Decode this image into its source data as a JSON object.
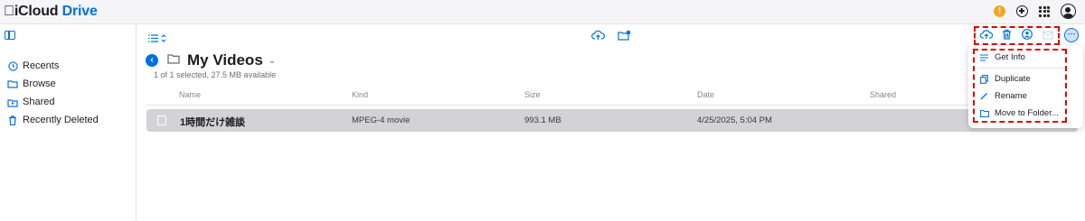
{
  "app": {
    "brand_prefix": "iCloud",
    "brand_name": "Drive"
  },
  "topbar": {
    "icons": [
      "warning-icon",
      "plus-circle-icon",
      "app-grid-icon",
      "account-icon"
    ],
    "warning_glyph": "!"
  },
  "sidebar": {
    "items": [
      {
        "label": "Recents",
        "icon": "clock-icon"
      },
      {
        "label": "Browse",
        "icon": "folder-icon"
      },
      {
        "label": "Shared",
        "icon": "shared-folder-icon"
      },
      {
        "label": "Recently Deleted",
        "icon": "trash-icon"
      }
    ]
  },
  "folder": {
    "title": "My Videos",
    "subtitle": "1 of 1 selected, 27.5 MB available"
  },
  "table": {
    "columns": [
      "Name",
      "Kind",
      "Size",
      "Date",
      "Shared"
    ],
    "rows": [
      {
        "name": "1時間だけ雑談",
        "kind": "MPEG-4 movie",
        "size": "993.1 MB",
        "date": "4/25/2025, 5:04 PM",
        "shared": ""
      }
    ]
  },
  "toolbar": {
    "icons": [
      "upload-icon",
      "trash-icon",
      "share-user-icon",
      "mail-icon"
    ]
  },
  "context_menu": {
    "items": [
      {
        "label": "Get Info",
        "icon": "info-lines-icon"
      },
      {
        "label": "Duplicate",
        "icon": "duplicate-icon"
      },
      {
        "label": "Rename",
        "icon": "pencil-icon"
      },
      {
        "label": "Move to Folder...",
        "icon": "move-folder-icon"
      }
    ]
  },
  "colors": {
    "accent": "#0071e3",
    "highlight_dash": "#e00000",
    "selected_row": "#d2d2d7",
    "warning": "#f5a623"
  }
}
